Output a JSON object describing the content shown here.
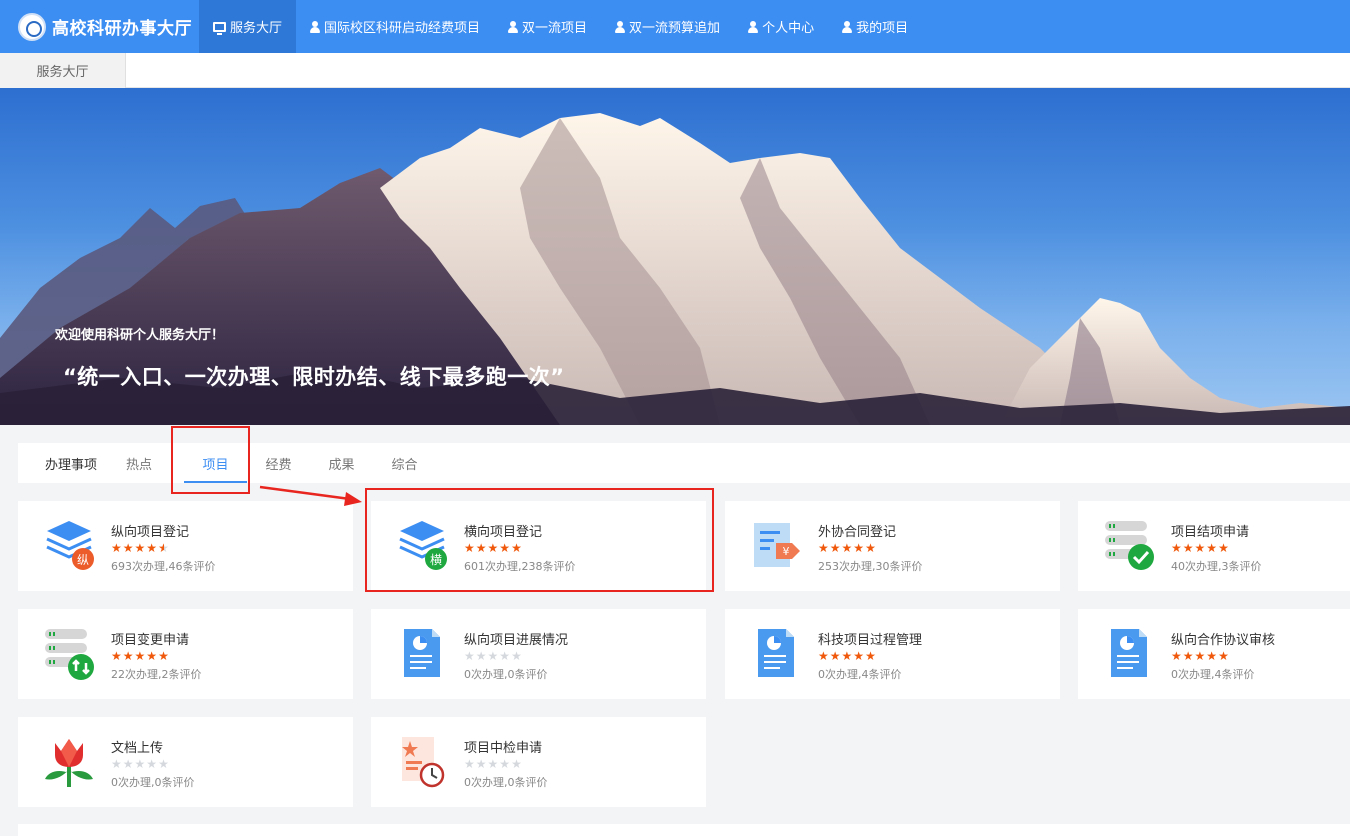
{
  "brand": {
    "title": "高校科研办事大厅"
  },
  "nav": {
    "items": [
      {
        "label": "服务大厅",
        "icon": "monitor-icon",
        "active": true
      },
      {
        "label": "国际校区科研启动经费项目",
        "icon": "user-icon"
      },
      {
        "label": "双一流项目",
        "icon": "user-icon"
      },
      {
        "label": "双一流预算追加",
        "icon": "user-icon"
      },
      {
        "label": "个人中心",
        "icon": "user-icon"
      },
      {
        "label": "我的项目",
        "icon": "user-icon"
      }
    ]
  },
  "tabstrip": {
    "active_tab": "服务大厅"
  },
  "banner": {
    "subtitle": "欢迎使用科研个人服务大厅！",
    "slogan": "“统一入口、一次办理、限时办结、线下最多跑一次”"
  },
  "categories": {
    "heading": "办理事项",
    "tabs": [
      "热点",
      "项目",
      "经费",
      "成果",
      "综合"
    ],
    "active": "项目"
  },
  "cards": [
    {
      "title": "纵向项目登记",
      "rating": 4.5,
      "meta": "693次办理,46条评价",
      "icon": "layers-zong-icon",
      "badge": "纵"
    },
    {
      "title": "横向项目登记",
      "rating": 5,
      "meta": "601次办理,238条评价",
      "icon": "layers-heng-icon",
      "badge": "横"
    },
    {
      "title": "外协合同登记",
      "rating": 5,
      "meta": "253次办理,30条评价",
      "icon": "contract-yuan-icon",
      "badge": "¥"
    },
    {
      "title": "项目结项申请",
      "rating": 5,
      "meta": "40次办理,3条评价",
      "icon": "server-check-icon"
    },
    {
      "title": "项目变更申请",
      "rating": 5,
      "meta": "22次办理,2条评价",
      "icon": "server-sync-icon"
    },
    {
      "title": "纵向项目进展情况",
      "rating": 0,
      "meta": "0次办理,0条评价",
      "icon": "document-chart-icon"
    },
    {
      "title": "科技项目过程管理",
      "rating": 5,
      "meta": "0次办理,4条评价",
      "icon": "document-chart-icon"
    },
    {
      "title": "纵向合作协议审核",
      "rating": 5,
      "meta": "0次办理,4条评价",
      "icon": "document-chart-icon"
    },
    {
      "title": "文档上传",
      "rating": 0,
      "meta": "0次办理,0条评价",
      "icon": "tulip-icon"
    },
    {
      "title": "项目中检申请",
      "rating": 0,
      "meta": "0次办理,0条评价",
      "icon": "document-clock-icon"
    }
  ],
  "colors": {
    "primary": "#3d8ef2",
    "nav_active": "#2e78d8",
    "star_on": "#f0590c",
    "star_off": "#d5d9de",
    "annotation_red": "#e8261f"
  }
}
